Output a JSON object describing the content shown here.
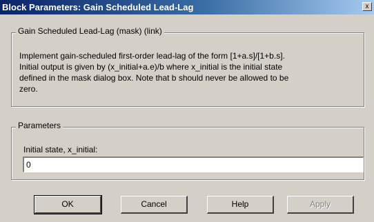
{
  "window": {
    "title": "Block Parameters: Gain Scheduled Lead-Lag",
    "close_glyph": "x"
  },
  "mask_group": {
    "legend": "Gain Scheduled Lead-Lag (mask) (link)",
    "description_lines": [
      "Implement gain-scheduled first-order lead-lag of the form [1+a.s]/[1+b.s].",
      "Initial output is given by (x_initial+a.e)/b where x_initial is the initial state",
      "defined in the mask dialog box. Note that b should never be allowed to be",
      "zero."
    ]
  },
  "parameters_group": {
    "legend": "Parameters",
    "initial_state_label": "Initial state, x_initial:",
    "initial_state_value": "0"
  },
  "buttons": {
    "ok": "OK",
    "cancel": "Cancel",
    "help": "Help",
    "apply": "Apply"
  }
}
